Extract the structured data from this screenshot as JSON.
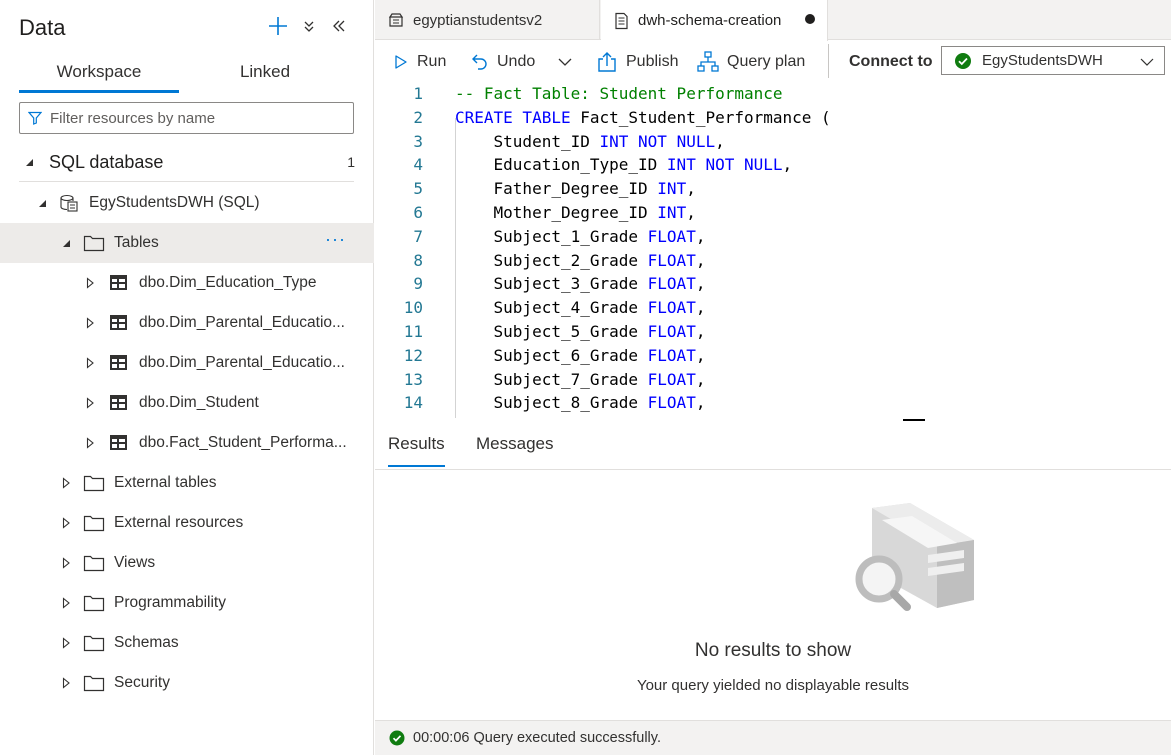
{
  "left_pane": {
    "title": "Data",
    "tabs": [
      "Workspace",
      "Linked"
    ],
    "filter_placeholder": "Filter resources by name",
    "section": {
      "label": "SQL database",
      "count": "1"
    },
    "tree": [
      {
        "label": "EgyStudentsDWH (SQL)",
        "icon": "sql-database-icon",
        "expanded": true
      },
      {
        "label": "Tables",
        "icon": "folder-icon",
        "expanded": true,
        "selected": true,
        "more": "···"
      },
      {
        "label": "dbo.Dim_Education_Type",
        "icon": "table-icon"
      },
      {
        "label": "dbo.Dim_Parental_Educatio...",
        "icon": "table-icon"
      },
      {
        "label": "dbo.Dim_Parental_Educatio...",
        "icon": "table-icon"
      },
      {
        "label": "dbo.Dim_Student",
        "icon": "table-icon"
      },
      {
        "label": "dbo.Fact_Student_Performa...",
        "icon": "table-icon"
      },
      {
        "label": "External tables",
        "icon": "folder-icon"
      },
      {
        "label": "External resources",
        "icon": "folder-icon"
      },
      {
        "label": "Views",
        "icon": "folder-icon"
      },
      {
        "label": "Programmability",
        "icon": "folder-icon"
      },
      {
        "label": "Schemas",
        "icon": "folder-icon"
      },
      {
        "label": "Security",
        "icon": "folder-icon"
      }
    ]
  },
  "doc_tabs": [
    {
      "label": "egyptianstudentsv2",
      "icon": "notebook-icon"
    },
    {
      "label": "dwh-schema-creation",
      "icon": "sql-script-icon",
      "unsaved": true
    }
  ],
  "toolbar": {
    "run": "Run",
    "undo": "Undo",
    "publish": "Publish",
    "query_plan": "Query plan",
    "connect_to": "Connect to",
    "connection": "EgyStudentsDWH"
  },
  "editor": {
    "lines": [
      {
        "n": "1",
        "tokens": [
          [
            "cm",
            "-- Fact Table: Student Performance"
          ]
        ]
      },
      {
        "n": "2",
        "tokens": [
          [
            "kw",
            "CREATE TABLE"
          ],
          [
            "",
            " Fact_Student_Performance ("
          ]
        ]
      },
      {
        "n": "3",
        "tokens": [
          [
            "",
            "    Student_ID "
          ],
          [
            "kw",
            "INT NOT NULL"
          ],
          [
            "",
            ","
          ]
        ]
      },
      {
        "n": "4",
        "tokens": [
          [
            "",
            "    Education_Type_ID "
          ],
          [
            "kw",
            "INT NOT NULL"
          ],
          [
            "",
            ","
          ]
        ]
      },
      {
        "n": "5",
        "tokens": [
          [
            "",
            "    Father_Degree_ID "
          ],
          [
            "kw",
            "INT"
          ],
          [
            "",
            ","
          ]
        ]
      },
      {
        "n": "6",
        "tokens": [
          [
            "",
            "    Mother_Degree_ID "
          ],
          [
            "kw",
            "INT"
          ],
          [
            "",
            ","
          ]
        ]
      },
      {
        "n": "7",
        "tokens": [
          [
            "",
            "    Subject_1_Grade "
          ],
          [
            "kw",
            "FLOAT"
          ],
          [
            "",
            ","
          ]
        ]
      },
      {
        "n": "8",
        "tokens": [
          [
            "",
            "    Subject_2_Grade "
          ],
          [
            "kw",
            "FLOAT"
          ],
          [
            "",
            ","
          ]
        ]
      },
      {
        "n": "9",
        "tokens": [
          [
            "",
            "    Subject_3_Grade "
          ],
          [
            "kw",
            "FLOAT"
          ],
          [
            "",
            ","
          ]
        ]
      },
      {
        "n": "10",
        "tokens": [
          [
            "",
            "    Subject_4_Grade "
          ],
          [
            "kw",
            "FLOAT"
          ],
          [
            "",
            ","
          ]
        ]
      },
      {
        "n": "11",
        "tokens": [
          [
            "",
            "    Subject_5_Grade "
          ],
          [
            "kw",
            "FLOAT"
          ],
          [
            "",
            ","
          ]
        ]
      },
      {
        "n": "12",
        "tokens": [
          [
            "",
            "    Subject_6_Grade "
          ],
          [
            "kw",
            "FLOAT"
          ],
          [
            "",
            ","
          ]
        ]
      },
      {
        "n": "13",
        "tokens": [
          [
            "",
            "    Subject_7_Grade "
          ],
          [
            "kw",
            "FLOAT"
          ],
          [
            "",
            ","
          ]
        ]
      },
      {
        "n": "14",
        "tokens": [
          [
            "",
            "    Subject_8_Grade "
          ],
          [
            "kw",
            "FLOAT"
          ],
          [
            "",
            ","
          ]
        ]
      }
    ]
  },
  "results": {
    "tabs": [
      "Results",
      "Messages"
    ],
    "empty_title": "No results to show",
    "empty_subtitle": "Your query yielded no displayable results"
  },
  "status": {
    "text": "00:00:06 Query executed successfully."
  },
  "colors": {
    "accent": "#0078d4",
    "success": "#107c10",
    "keyword": "#0000ff",
    "comment": "#008000",
    "line_number": "#237893"
  }
}
